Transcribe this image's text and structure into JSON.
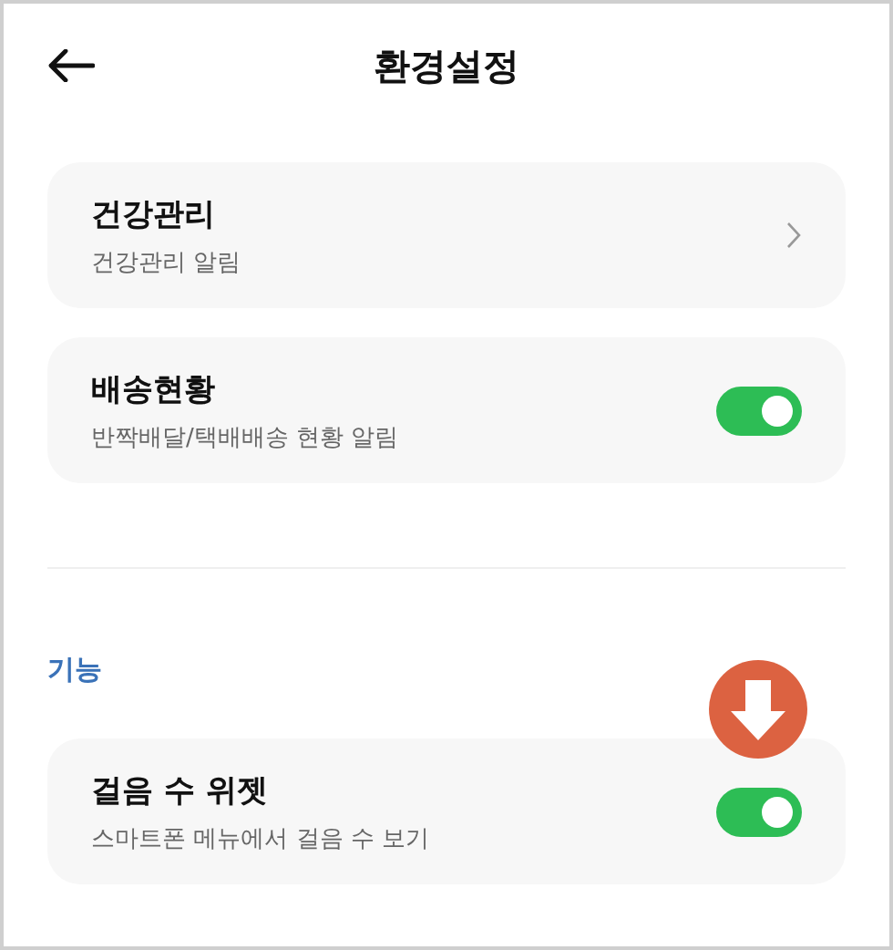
{
  "header": {
    "title": "환경설정"
  },
  "groups": [
    {
      "items": [
        {
          "kind": "link",
          "title": "건강관리",
          "subtitle": "건강관리 알림"
        },
        {
          "kind": "toggle",
          "title": "배송현황",
          "subtitle": "반짝배달/택배배송 현황 알림",
          "on": true
        }
      ]
    },
    {
      "label": "기능",
      "items": [
        {
          "kind": "toggle",
          "title": "걸음 수 위젯",
          "subtitle": "스마트폰 메뉴에서 걸음 수 보기",
          "on": true
        }
      ]
    }
  ]
}
